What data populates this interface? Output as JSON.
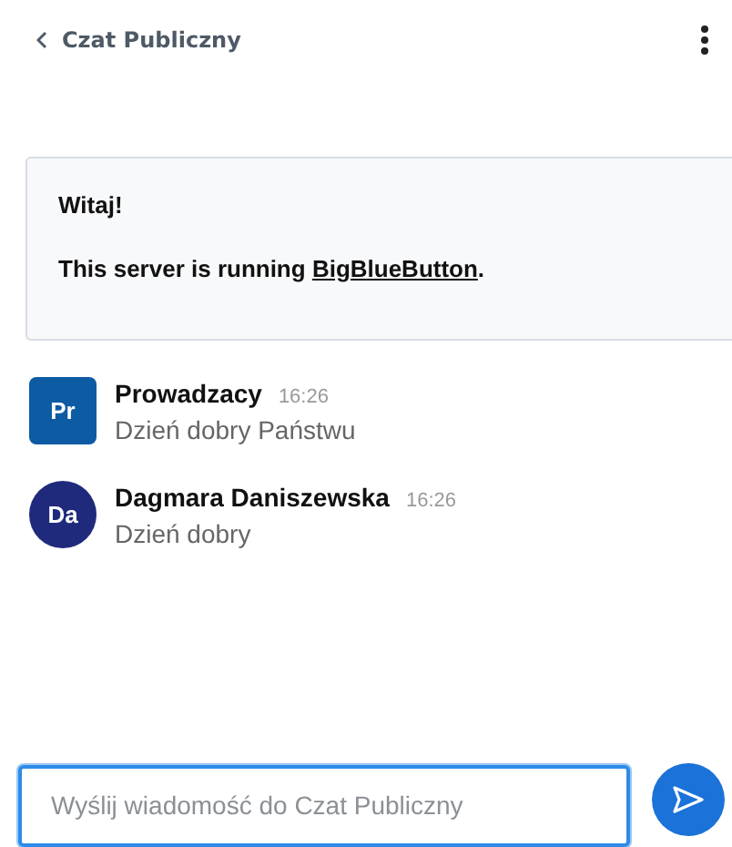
{
  "header": {
    "back_label": "Czat Publiczny"
  },
  "welcome": {
    "title": "Witaj!",
    "text_before": "This server is running ",
    "link": "BigBlueButton",
    "text_after": "."
  },
  "messages": [
    {
      "initials": "Pr",
      "kind": "moderator",
      "color": "#0c5ba3",
      "name": "Prowadzacy",
      "time": "16:26",
      "text": "Dzień dobry Państwu"
    },
    {
      "initials": "Da",
      "kind": "viewer",
      "color": "#1f2a7c",
      "name": "Dagmara Daniszewska",
      "time": "16:26",
      "text": "Dzień dobry"
    }
  ],
  "composer": {
    "placeholder": "Wyślij wiadomość do Czat Publiczny"
  }
}
